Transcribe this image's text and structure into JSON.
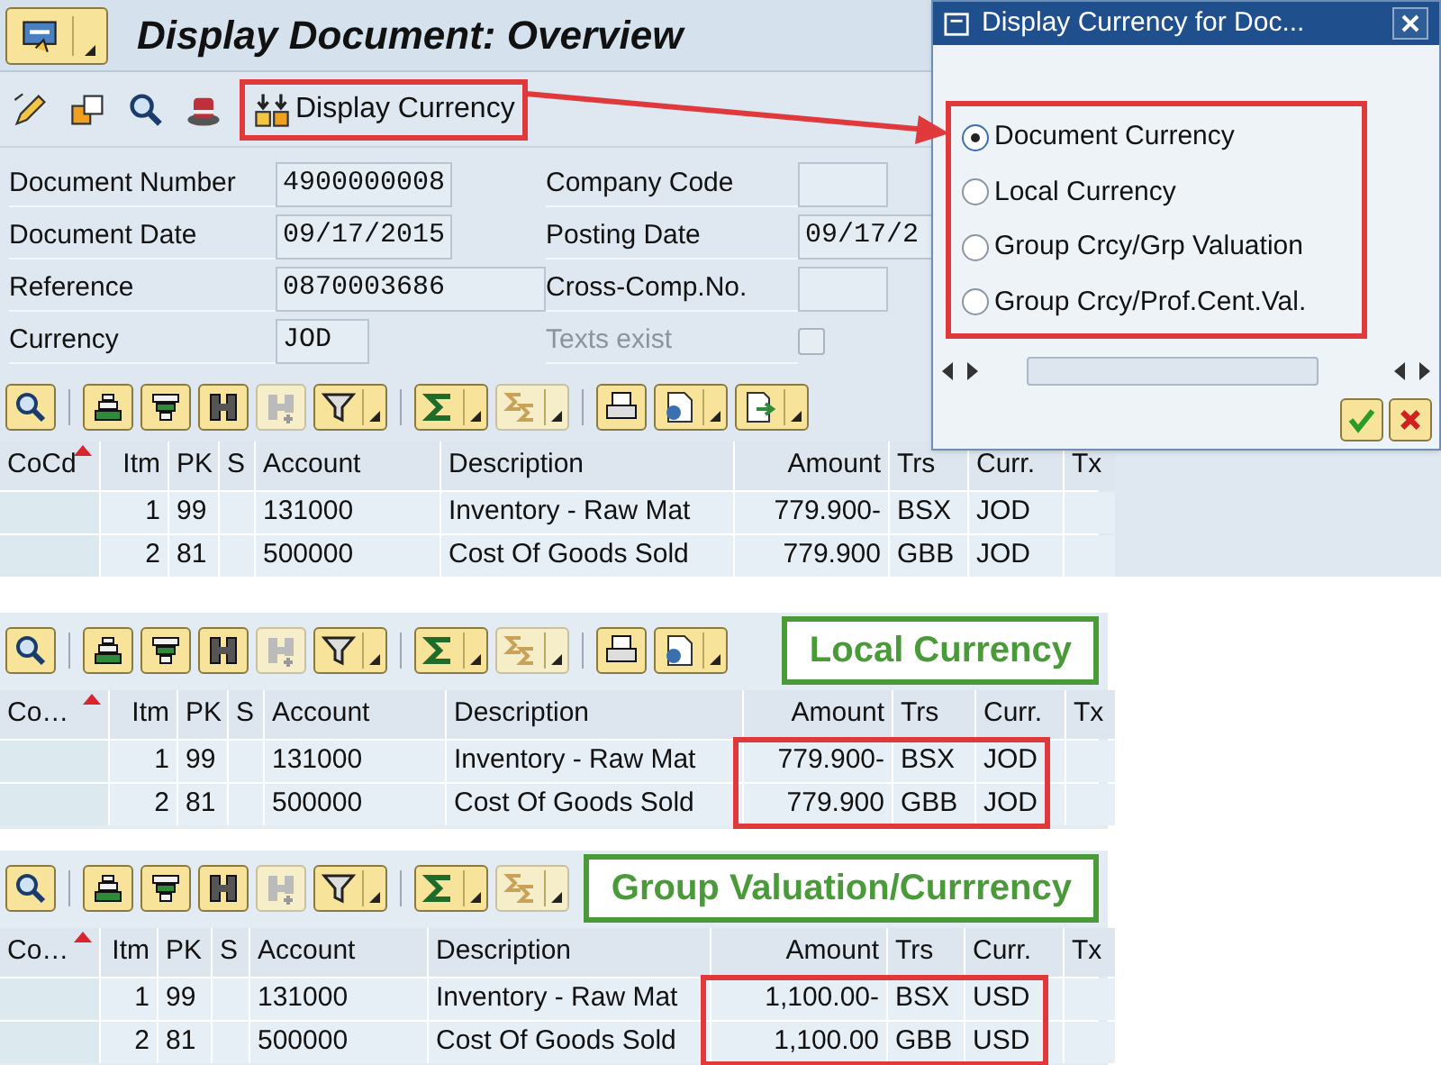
{
  "header": {
    "title": "Display Document: Overview"
  },
  "toolbar": {
    "display_currency_button": "Display Currency"
  },
  "document_fields": [
    {
      "label": "Document Number",
      "value": "4900000008"
    },
    {
      "label": "Company Code"
    },
    {
      "label": "Document Date",
      "value": "09/17/2015"
    },
    {
      "label": "Posting Date",
      "value": "09/17/2"
    },
    {
      "label": "Reference",
      "value": "0870003686"
    },
    {
      "label": "Cross-Comp.No."
    },
    {
      "label": "Currency",
      "value": "JOD"
    },
    {
      "label": "Texts exist",
      "kind": "checkbox",
      "checked": false,
      "disabled": true
    }
  ],
  "popup": {
    "title": "Display Currency for Doc...",
    "options": [
      {
        "label": "Document Currency",
        "selected": true
      },
      {
        "label": "Local Currency",
        "selected": false
      },
      {
        "label": "Group Crcy/Grp Valuation",
        "selected": false
      },
      {
        "label": "Group Crcy/Prof.Cent.Val.",
        "selected": false
      }
    ]
  },
  "views": [
    {
      "table": {
        "columns": [
          "CoCd",
          "Itm",
          "PK",
          "S",
          "Account",
          "Description",
          "Amount",
          "Trs",
          "Curr.",
          "Tx"
        ],
        "rows": [
          [
            "",
            "1",
            "99",
            "",
            "131000",
            "Inventory - Raw Mat",
            "779.900-",
            "BSX",
            "JOD",
            ""
          ],
          [
            "",
            "2",
            "81",
            "",
            "500000",
            "Cost Of Goods Sold",
            "779.900",
            "GBB",
            "JOD",
            ""
          ]
        ]
      }
    },
    {
      "caption": "Local Currency",
      "highlight_amounts": true,
      "table": {
        "columns": [
          "Co…",
          "Itm",
          "PK",
          "S",
          "Account",
          "Description",
          "Amount",
          "Trs",
          "Curr.",
          "Tx"
        ],
        "rows": [
          [
            "",
            "1",
            "99",
            "",
            "131000",
            "Inventory - Raw Mat",
            "779.900-",
            "BSX",
            "JOD",
            ""
          ],
          [
            "",
            "2",
            "81",
            "",
            "500000",
            "Cost Of Goods Sold",
            "779.900",
            "GBB",
            "JOD",
            ""
          ]
        ]
      }
    },
    {
      "caption": "Group Valuation/Currrency",
      "highlight_amounts": true,
      "table": {
        "columns": [
          "Co…",
          "Itm",
          "PK",
          "S",
          "Account",
          "Description",
          "Amount",
          "Trs",
          "Curr.",
          "Tx"
        ],
        "rows": [
          [
            "",
            "1",
            "99",
            "",
            "131000",
            "Inventory - Raw Mat",
            "1,100.00-",
            "BSX",
            "USD",
            ""
          ],
          [
            "",
            "2",
            "81",
            "",
            "500000",
            "Cost Of Goods Sold",
            "1,100.00",
            "GBB",
            "USD",
            ""
          ]
        ]
      }
    }
  ]
}
